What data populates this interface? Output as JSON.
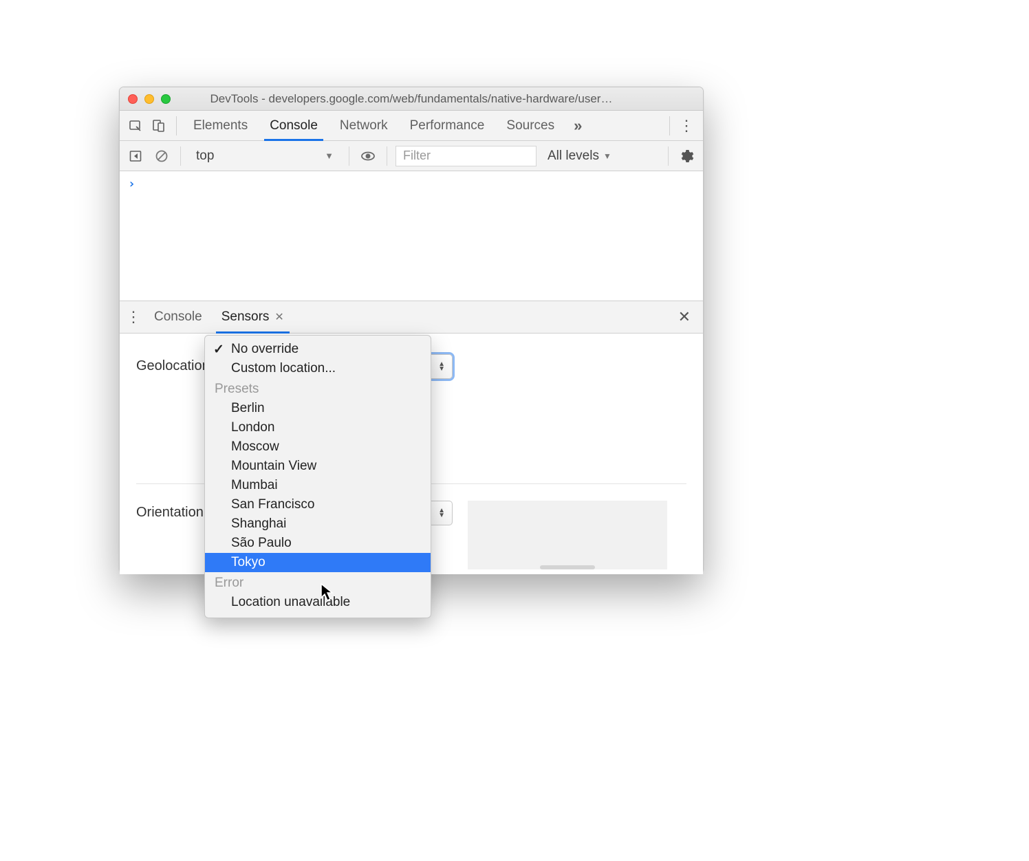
{
  "window_title": "DevTools - developers.google.com/web/fundamentals/native-hardware/user…",
  "top_tabs": {
    "elements": "Elements",
    "console": "Console",
    "network": "Network",
    "performance": "Performance",
    "sources": "Sources"
  },
  "active_top_tab": "Console",
  "console_bar": {
    "context": "top",
    "filter_placeholder": "Filter",
    "levels": "All levels"
  },
  "drawer_tabs": {
    "console": "Console",
    "sensors": "Sensors"
  },
  "active_drawer_tab": "Sensors",
  "sensors": {
    "geolocation_label": "Geolocation",
    "orientation_label": "Orientation"
  },
  "geo_dropdown": {
    "no_override": "No override",
    "custom": "Custom location...",
    "group_presets": "Presets",
    "presets": [
      "Berlin",
      "London",
      "Moscow",
      "Mountain View",
      "Mumbai",
      "San Francisco",
      "Shanghai",
      "São Paulo",
      "Tokyo"
    ],
    "group_error": "Error",
    "error_item": "Location unavailable",
    "selected": "No override",
    "highlighted": "Tokyo"
  }
}
